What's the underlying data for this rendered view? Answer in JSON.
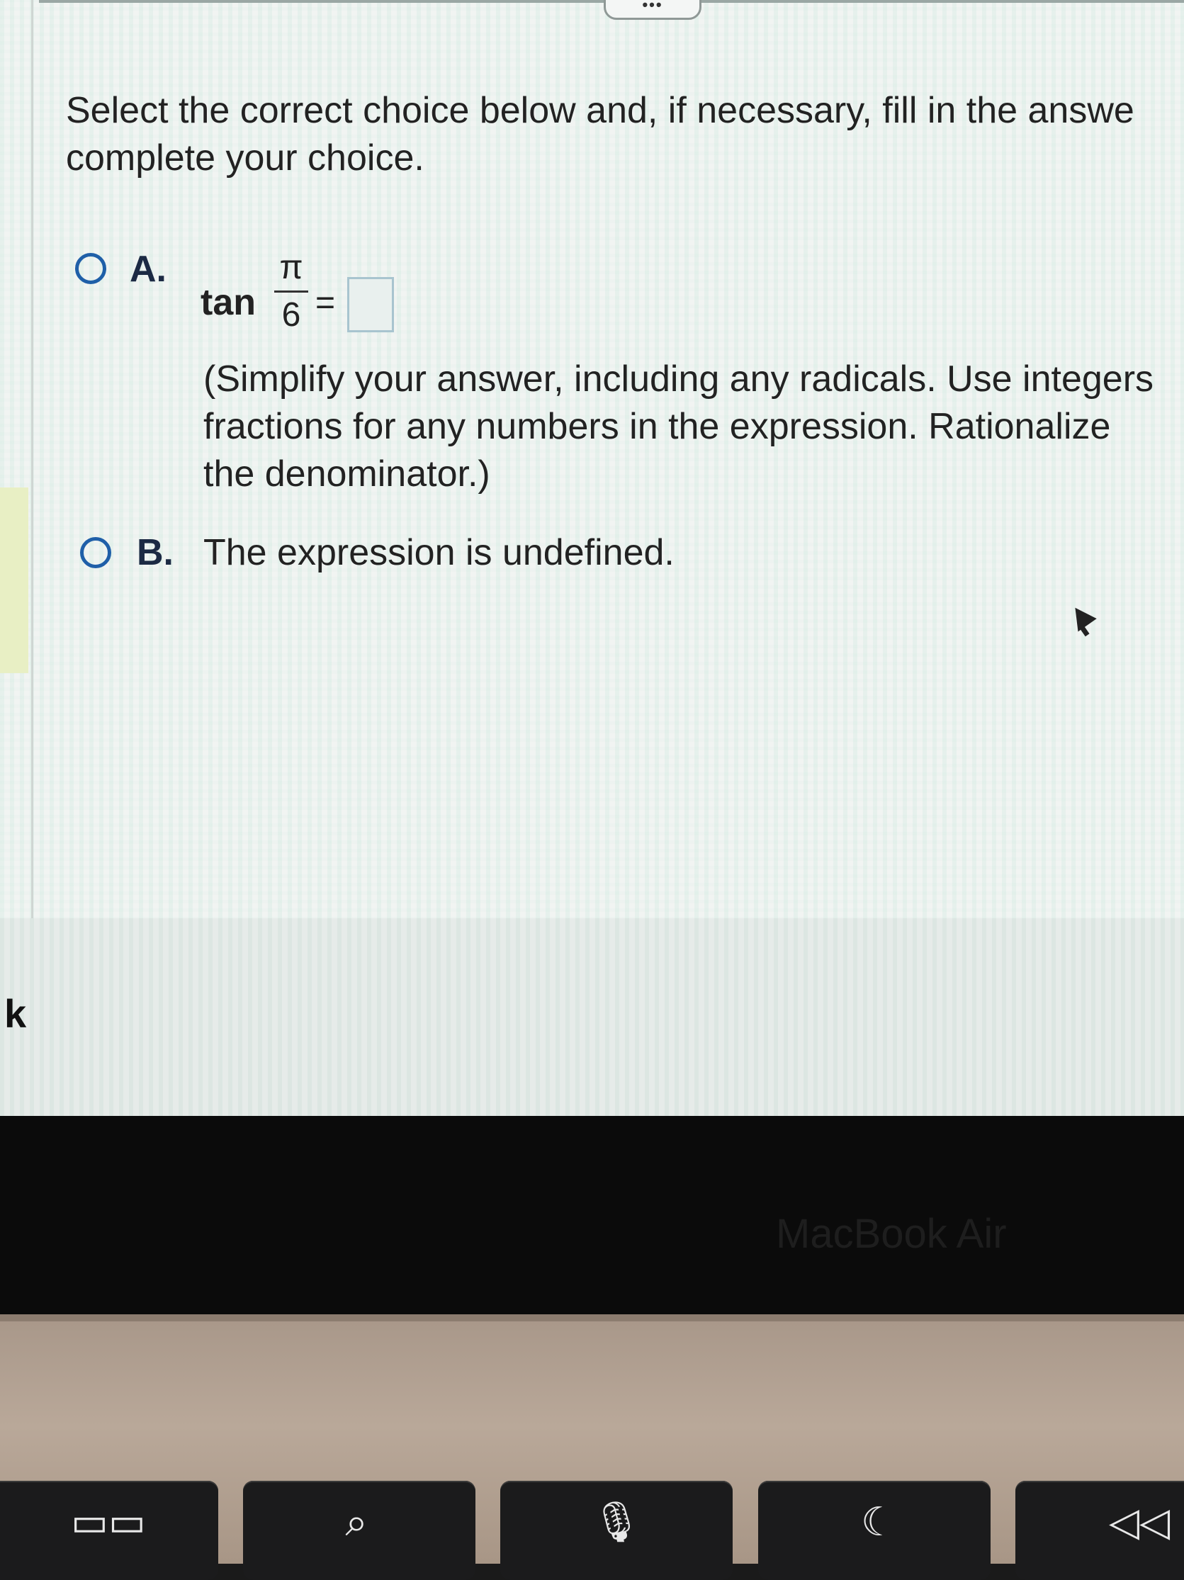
{
  "question": {
    "instructions": "Select the correct choice below and, if necessary, fill in the answe\ncomplete your choice.",
    "choices": [
      {
        "letter": "A.",
        "function": "tan",
        "numerator": "π",
        "denominator": "6",
        "equals": "=",
        "answer_value": "",
        "hint": "(Simplify your answer, including any radicals. Use integers\nfractions for any numbers in the expression. Rationalize\nthe denominator.)"
      },
      {
        "letter": "B.",
        "text": "The expression is undefined."
      }
    ]
  },
  "toolbar": {
    "more_label": "•••"
  },
  "side_text": "k",
  "laptop": {
    "brand": "MacBook Air"
  },
  "keys": [
    {
      "icon": "mission-control-icon",
      "glyph": "▭▭"
    },
    {
      "icon": "search-icon",
      "glyph": "⌕"
    },
    {
      "icon": "microphone-icon",
      "glyph": "🎙"
    },
    {
      "icon": "moon-icon",
      "glyph": "☾"
    },
    {
      "icon": "rewind-icon",
      "glyph": "◁◁"
    }
  ],
  "colors": {
    "radio": "#1f5fa8",
    "text": "#222222",
    "answer_box_border": "#a8c4cf"
  }
}
